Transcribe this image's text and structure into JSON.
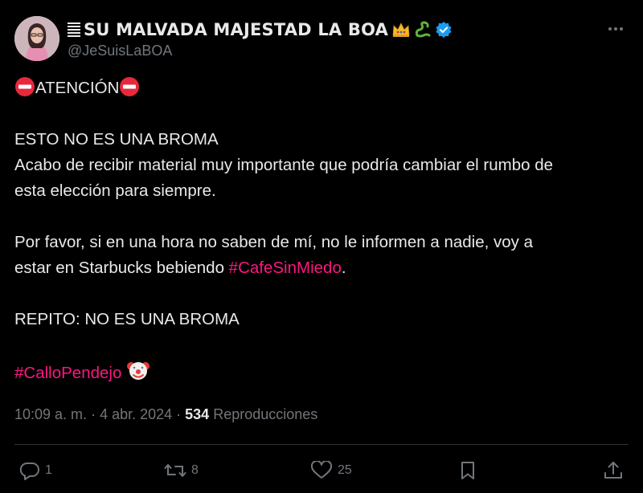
{
  "author": {
    "display_name": "SU MALVADA MAJESTAD LA BOA",
    "handle": "@JeSuisLaBOA",
    "verified_color": "#1d9bf0"
  },
  "tweet": {
    "headline": "ATENCIÓN",
    "line1": "ESTO NO ES UNA BROMA",
    "line2": "Acabo de recibir material muy importante que podría cambiar el rumbo de",
    "line3": "esta elección para siempre.",
    "line4": "Por favor, si en una hora no saben de mí, no le informen a nadie, voy a",
    "line5_prefix": "estar en Starbucks bebiendo ",
    "hashtag1": "#CafeSinMiedo",
    "line5_suffix": ".",
    "line6": "REPITO: NO ES UNA BROMA",
    "hashtag2": "#CalloPendejo"
  },
  "meta": {
    "time": "10:09 a. m.",
    "separator1": " · ",
    "date": "4 abr. 2024",
    "separator2": " · ",
    "views_count": "534",
    "views_label": " Reproducciones"
  },
  "actions": {
    "replies": "1",
    "reposts": "8",
    "likes": "25"
  },
  "icons": {
    "verified": "verified-badge-icon",
    "crown": "crown-emoji-icon",
    "snake": "snake-emoji-icon",
    "no_entry": "no-entry-emoji-icon",
    "clown": "clown-emoji-icon",
    "more": "more-options-icon",
    "reply": "reply-icon",
    "repost": "repost-icon",
    "like": "heart-icon",
    "bookmark": "bookmark-icon",
    "share": "share-icon"
  },
  "colors": {
    "background": "#000000",
    "text": "#e7e9ea",
    "secondary": "#71767b",
    "hashtag": "#f91880",
    "divider": "#2f3336"
  }
}
